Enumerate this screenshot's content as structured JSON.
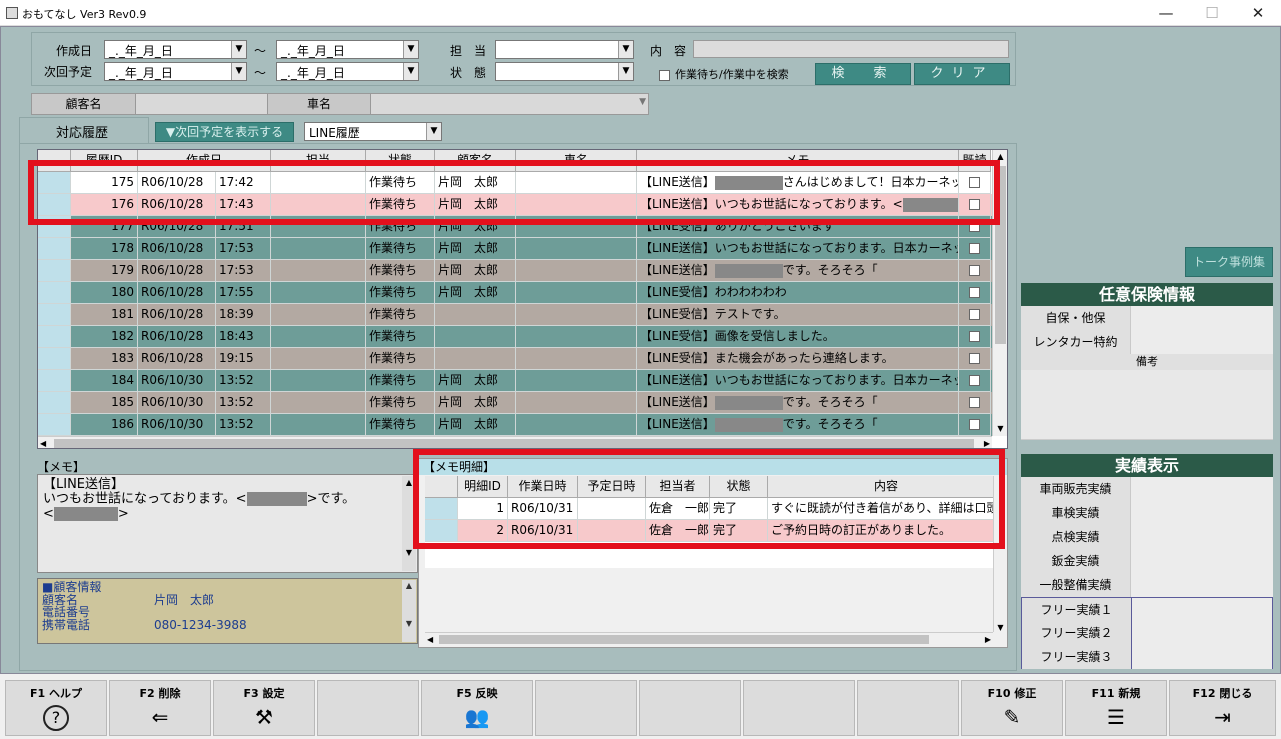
{
  "window": {
    "title": "おもてなし Ver3 Rev0.9",
    "min_glyph": "—",
    "max_glyph": "☐",
    "close_glyph": "✕"
  },
  "search": {
    "created_label": "作成日",
    "next_label": "次回予定",
    "date_placeholder": "_._年_月_日",
    "tilde": "〜",
    "staff_label": "担　当",
    "status_label": "状　態",
    "content_label": "内　容",
    "checkbox_label": "作業待ち/作業中を検索",
    "search_button": "検　索",
    "clear_button": "クリア"
  },
  "customer_bar": {
    "customer_label": "顧客名",
    "car_label": "車名"
  },
  "tabs": {
    "history_label": "対応履歴",
    "show_next_button": "▼次回予定を表示する",
    "line_combo": "LINE履歴"
  },
  "history_table": {
    "headers": [
      "履歴ID",
      "作成日",
      "",
      "担当",
      "状態",
      "顧客名",
      "車名",
      "メモ",
      "既読"
    ],
    "rows": [
      {
        "id": "175",
        "date": "R06/10/28",
        "time": "17:42",
        "staff": "",
        "status": "作業待ち",
        "customer": "片岡　太郎",
        "car": "",
        "memo_pre": "【LINE送信】",
        "memo_post": "さんはじめまして！日本カーネット株式",
        "masked": true,
        "style": "white"
      },
      {
        "id": "176",
        "date": "R06/10/28",
        "time": "17:43",
        "staff": "",
        "status": "作業待ち",
        "customer": "片岡　太郎",
        "car": "",
        "memo_pre": "【LINE送信】いつもお世話になっております。<",
        "memo_post": ">",
        "masked": true,
        "style": "pink"
      },
      {
        "id": "177",
        "date": "R06/10/28",
        "time": "17:51",
        "staff": "",
        "status": "作業待ち",
        "customer": "片岡　太郎",
        "car": "",
        "memo_pre": "【LINE受信】ありがとうございます",
        "memo_post": "",
        "masked": false,
        "style": "teal"
      },
      {
        "id": "178",
        "date": "R06/10/28",
        "time": "17:53",
        "staff": "",
        "status": "作業待ち",
        "customer": "片岡　太郎",
        "car": "",
        "memo_pre": "【LINE送信】いつもお世話になっております。日本カーネッ",
        "memo_post": "",
        "masked": false,
        "style": "teal"
      },
      {
        "id": "179",
        "date": "R06/10/28",
        "time": "17:53",
        "staff": "",
        "status": "作業待ち",
        "customer": "片岡　太郎",
        "car": "",
        "memo_pre": "【LINE送信】",
        "memo_post": "です。そろそろ「",
        "masked": true,
        "style": "tan"
      },
      {
        "id": "180",
        "date": "R06/10/28",
        "time": "17:55",
        "staff": "",
        "status": "作業待ち",
        "customer": "片岡　太郎",
        "car": "",
        "memo_pre": "【LINE受信】わわわわわわ",
        "memo_post": "",
        "masked": false,
        "style": "teal"
      },
      {
        "id": "181",
        "date": "R06/10/28",
        "time": "18:39",
        "staff": "",
        "status": "作業待ち",
        "customer": "",
        "car": "",
        "memo_pre": "【LINE受信】テストです。",
        "memo_post": "",
        "masked": false,
        "style": "tan"
      },
      {
        "id": "182",
        "date": "R06/10/28",
        "time": "18:43",
        "staff": "",
        "status": "作業待ち",
        "customer": "",
        "car": "",
        "memo_pre": "【LINE受信】画像を受信しました。",
        "memo_post": "",
        "masked": false,
        "style": "teal"
      },
      {
        "id": "183",
        "date": "R06/10/28",
        "time": "19:15",
        "staff": "",
        "status": "作業待ち",
        "customer": "",
        "car": "",
        "memo_pre": "【LINE受信】また機会があったら連絡します。",
        "memo_post": "",
        "masked": false,
        "style": "tan"
      },
      {
        "id": "184",
        "date": "R06/10/30",
        "time": "13:52",
        "staff": "",
        "status": "作業待ち",
        "customer": "片岡　太郎",
        "car": "",
        "memo_pre": "【LINE送信】いつもお世話になっております。日本カーネッ",
        "memo_post": "",
        "masked": false,
        "style": "teal"
      },
      {
        "id": "185",
        "date": "R06/10/30",
        "time": "13:52",
        "staff": "",
        "status": "作業待ち",
        "customer": "片岡　太郎",
        "car": "",
        "memo_pre": "【LINE送信】",
        "memo_post": "です。そろそろ「",
        "masked": true,
        "style": "tan"
      },
      {
        "id": "186",
        "date": "R06/10/30",
        "time": "13:52",
        "staff": "",
        "status": "作業待ち",
        "customer": "片岡　太郎",
        "car": "",
        "memo_pre": "【LINE送信】",
        "memo_post": "です。そろそろ「",
        "masked": true,
        "style": "teal"
      }
    ]
  },
  "memo": {
    "title": "【メモ】",
    "line1": "【LINE送信】",
    "line2_pre": "いつもお世話になっております。<",
    "line2_post": ">です。",
    "line3_pre": "<",
    "line3_post": ">"
  },
  "customer_info": {
    "title": "■顧客情報",
    "name_label": "顧客名",
    "name_value": "片岡　太郎",
    "phone_label": "電話番号",
    "mobile_label": "携帯電話",
    "mobile_value": "080-1234-3988"
  },
  "memo_detail": {
    "title": "【メモ明細】",
    "headers": [
      "明細ID",
      "作業日時",
      "予定日時",
      "担当者",
      "状態",
      "内容"
    ],
    "rows": [
      {
        "id": "1",
        "work": "R06/10/31",
        "plan": "",
        "staff": "佐倉　一郎",
        "status": "完了",
        "content": "すぐに既読が付き着信があり、詳細は口頭"
      },
      {
        "id": "2",
        "work": "R06/10/31",
        "plan": "",
        "staff": "佐倉　一郎",
        "status": "完了",
        "content": "ご予約日時の訂正がありました。"
      }
    ]
  },
  "side": {
    "talk_button": "トーク事例集",
    "insurance_title": "任意保険情報",
    "insurance_rows": [
      "自保・他保",
      "レンタカー特約"
    ],
    "note_label": "備考",
    "results_title": "実績表示",
    "results_rows": [
      "車両販売実績",
      "車検実績",
      "点検実績",
      "鈑金実績",
      "一般整備実績"
    ],
    "free_rows": [
      "フリー実績１",
      "フリー実績２",
      "フリー実績３"
    ]
  },
  "fkeys": [
    {
      "label": "F1 ヘルプ",
      "icon": "?"
    },
    {
      "label": "F2 削除",
      "icon": "⇐"
    },
    {
      "label": "F3 設定",
      "icon": "⚒"
    },
    {
      "label": "",
      "icon": ""
    },
    {
      "label": "F5 反映",
      "icon": "👥"
    },
    {
      "label": "",
      "icon": ""
    },
    {
      "label": "",
      "icon": ""
    },
    {
      "label": "",
      "icon": ""
    },
    {
      "label": "F10 修正",
      "icon": "✎"
    },
    {
      "label": "F11 新規",
      "icon": "☰"
    },
    {
      "label": "F12 閉じる",
      "icon": "⇥"
    }
  ]
}
